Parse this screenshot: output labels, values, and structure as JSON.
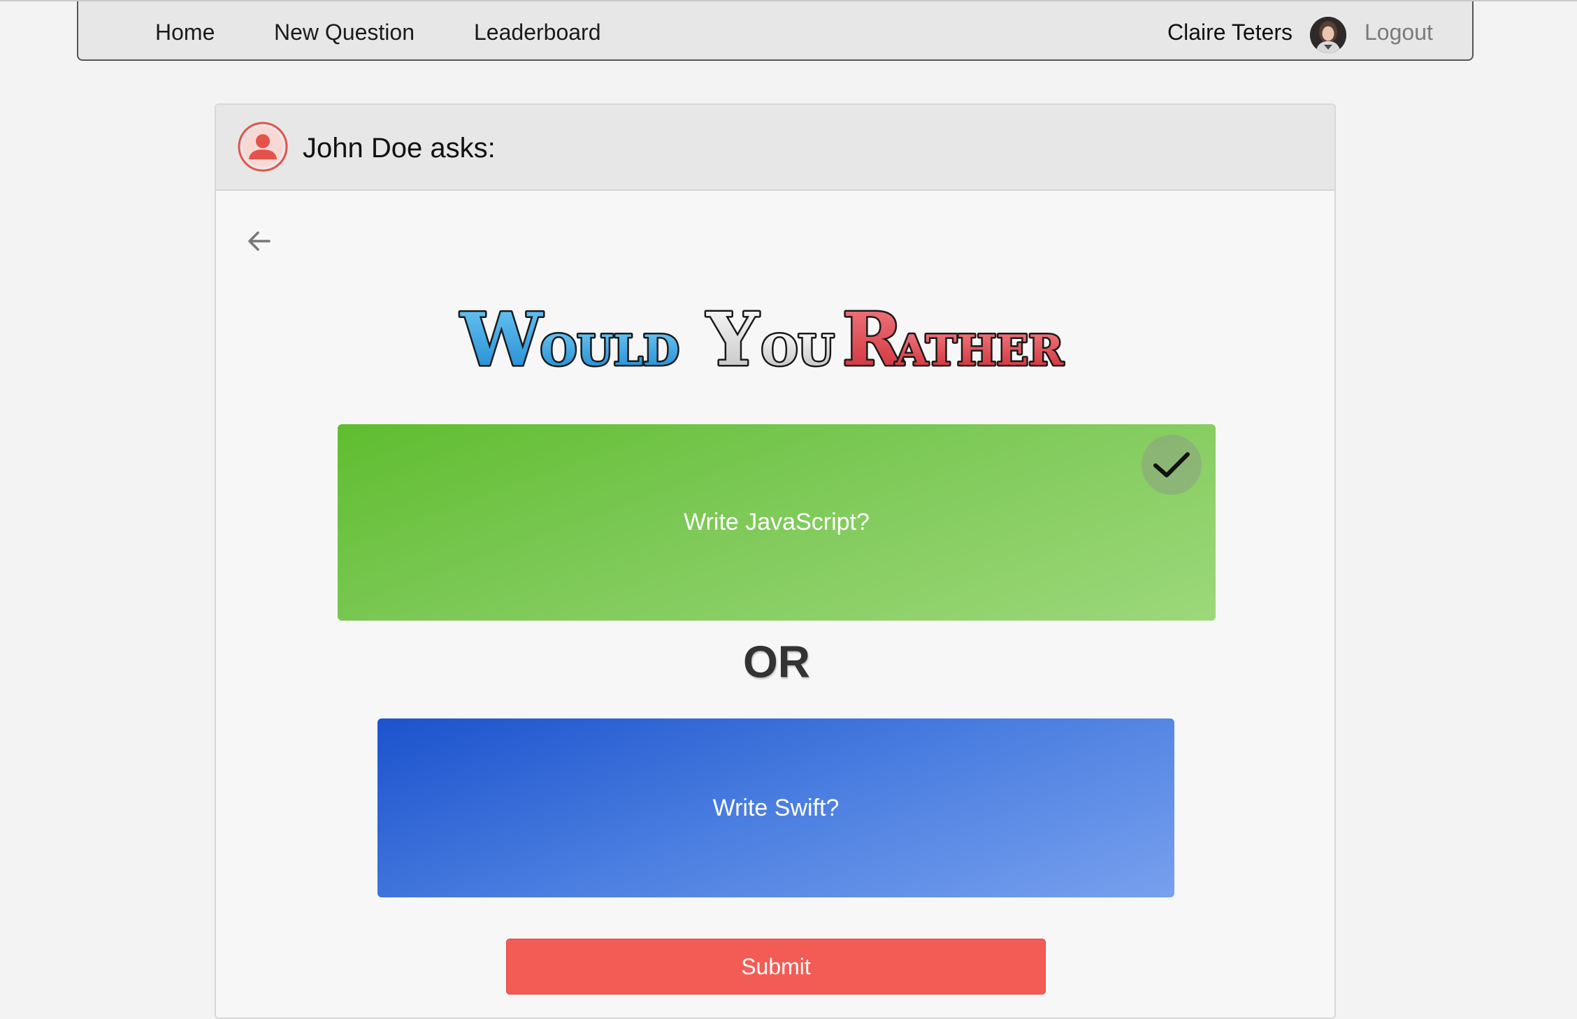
{
  "nav": {
    "home_label": "Home",
    "new_question_label": "New Question",
    "leaderboard_label": "Leaderboard",
    "user_name": "Claire Teters",
    "logout_label": "Logout"
  },
  "question": {
    "asker_text": "John Doe asks:",
    "logo_text": "Would You Rather",
    "option_one": "Write JavaScript?",
    "separator": "OR",
    "option_two": "Write Swift?",
    "selected_option": "option_one",
    "submit_label": "Submit"
  },
  "colors": {
    "option_one_bg": "#6bc23f",
    "option_two_bg": "#3f72dc",
    "submit_bg": "#f35c55",
    "avatar_accent": "#e4524a",
    "logo_blue": "#2fa6e6",
    "logo_red": "#e23a43"
  },
  "icons": {
    "back": "arrow-left-icon",
    "check": "check-icon",
    "asker": "user-avatar-icon"
  }
}
